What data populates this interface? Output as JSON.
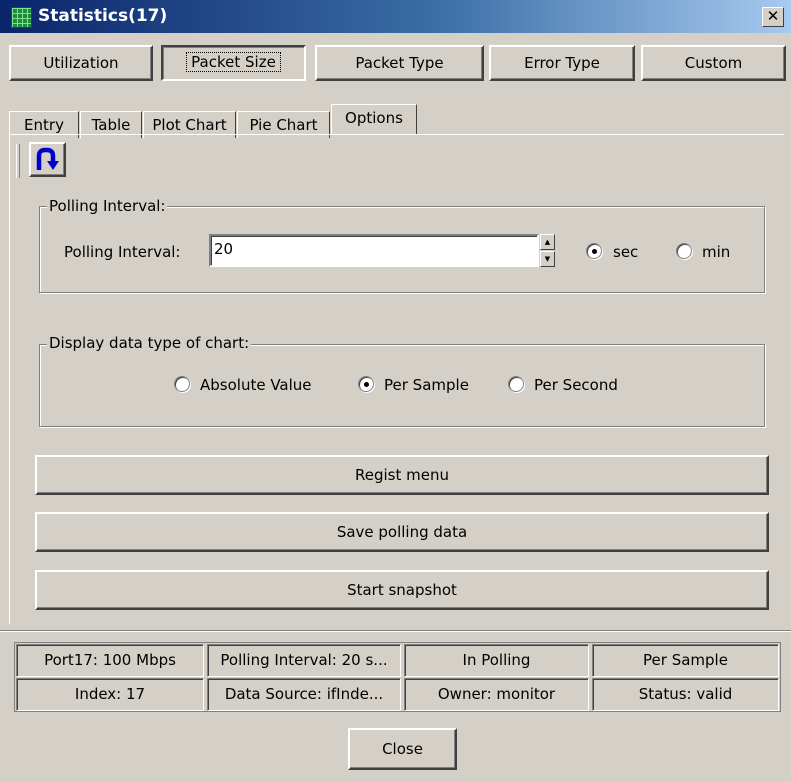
{
  "window": {
    "title": "Statistics(17)",
    "close_glyph": "✕"
  },
  "top_buttons": [
    "Utilization",
    "Packet Size",
    "Packet Type",
    "Error Type",
    "Custom"
  ],
  "tabs": [
    "Entry",
    "Table",
    "Plot Chart",
    "Pie Chart",
    "Options"
  ],
  "active_tab": "Options",
  "toolbar": {
    "refresh_icon": "refresh-arrow-icon",
    "accent": "#0000cc"
  },
  "polling_group": {
    "legend": "Polling Interval:",
    "label": "Polling Interval:",
    "value": "20",
    "unit_options": [
      "sec",
      "min"
    ],
    "unit_selected": "sec"
  },
  "display_group": {
    "legend": "Display data type of chart:",
    "options": [
      "Absolute Value",
      "Per Sample",
      "Per Second"
    ],
    "selected": "Per Sample"
  },
  "actions": [
    "Regist menu",
    "Save polling data",
    "Start snapshot"
  ],
  "status_grid": [
    [
      "Port17: 100 Mbps",
      "Polling Interval: 20 s...",
      "In Polling",
      "Per Sample"
    ],
    [
      "Index: 17",
      "Data Source: ifInde...",
      "Owner: monitor",
      "Status: valid"
    ]
  ],
  "close_button": "Close",
  "colors": {
    "title_start": "#0a246a",
    "title_end": "#a6caf0",
    "face": "#d4d0c8"
  }
}
